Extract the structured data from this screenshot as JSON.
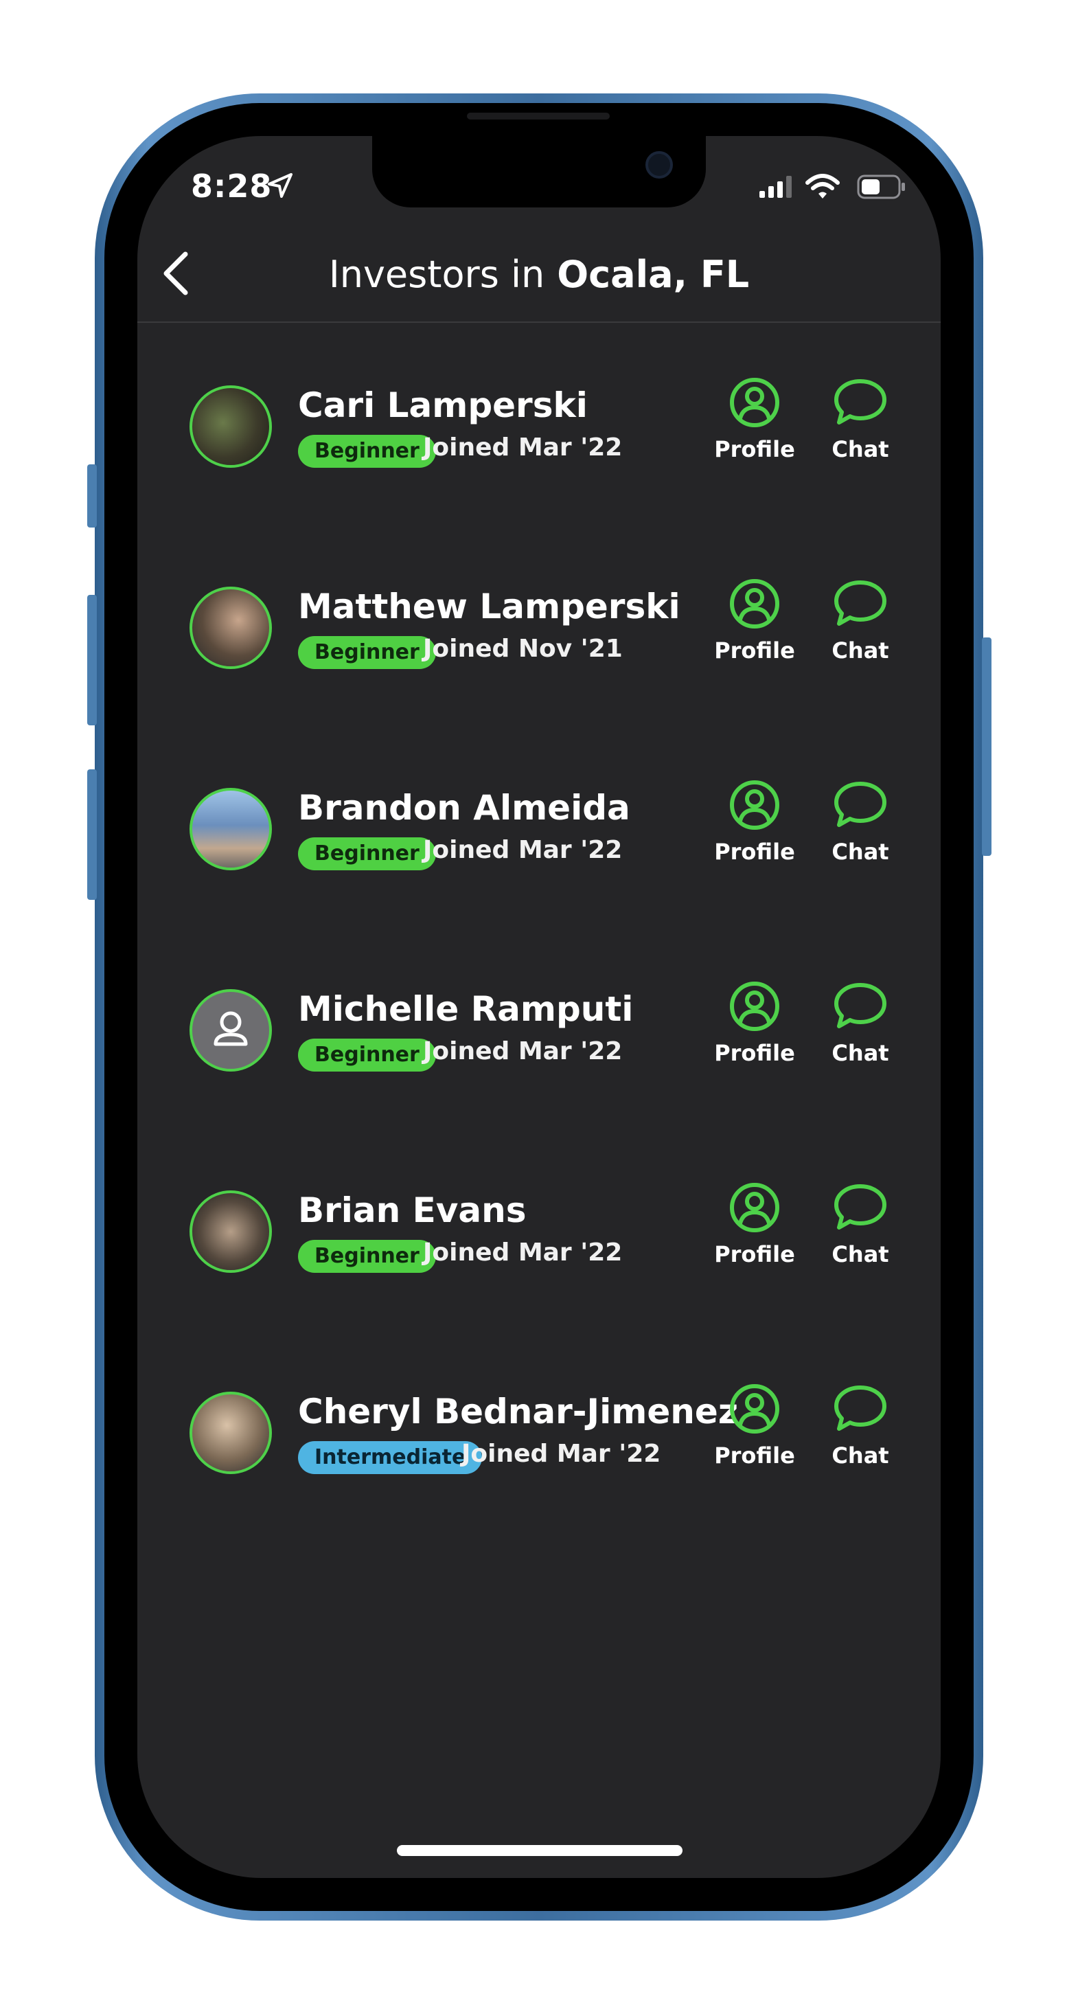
{
  "status_bar": {
    "time": "8:28"
  },
  "header": {
    "title_prefix": "Investors in",
    "city": "Ocala, FL"
  },
  "actions": {
    "profile_label": "Profile",
    "chat_label": "Chat"
  },
  "investors": [
    {
      "name": "Cari Lamperski",
      "level": "Beginner",
      "joined": "Joined Mar '22"
    },
    {
      "name": "Matthew Lamperski",
      "level": "Beginner",
      "joined": "Joined Nov '21"
    },
    {
      "name": "Brandon Almeida",
      "level": "Beginner",
      "joined": "Joined Mar '22"
    },
    {
      "name": "Michelle Ramputi",
      "level": "Beginner",
      "joined": "Joined Mar '22"
    },
    {
      "name": "Brian Evans",
      "level": "Beginner",
      "joined": "Joined Mar '22"
    },
    {
      "name": "Cheryl Bednar-Jimenez",
      "level": "Intermediate",
      "joined": "Joined Mar '22"
    }
  ],
  "colors": {
    "accent_green": "#4ed14a",
    "intermediate_blue": "#4fb4e2",
    "background": "#252527"
  }
}
